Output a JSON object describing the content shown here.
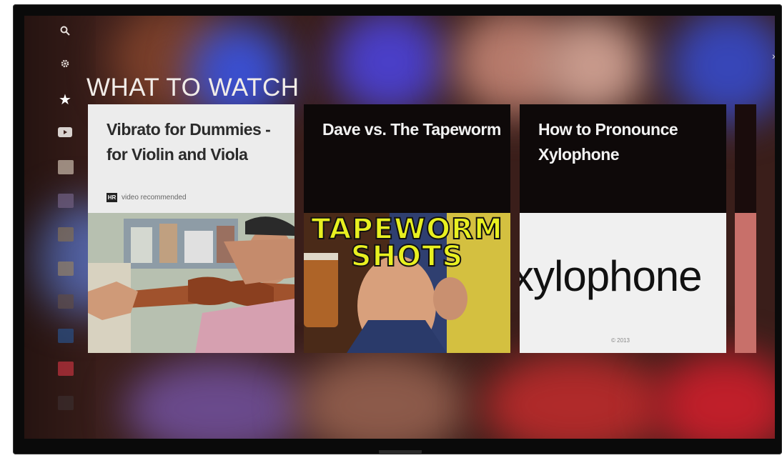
{
  "section": {
    "title": "WHAT TO WATCH"
  },
  "rail": {
    "items": [
      {
        "name": "search",
        "glyph": "🔍"
      },
      {
        "name": "settings",
        "glyph": "⚙"
      },
      {
        "name": "featured",
        "glyph": "★"
      },
      {
        "name": "youtube",
        "glyph": "▶"
      }
    ]
  },
  "cards": [
    {
      "title": "Vibrato for Dummies - for Violin and Viola",
      "badge": "video recommended"
    },
    {
      "title": "Dave vs. The Tapeworm",
      "media_text_line1": "TAPEWORM",
      "media_text_line2": "SHOTS"
    },
    {
      "title": "How to Pronounce Xylophone",
      "media_text": "xylophone",
      "media_footnote": "© 2013"
    }
  ],
  "colors": {
    "accent_yellow": "#e8f020",
    "title_text": "#f1ece8"
  }
}
